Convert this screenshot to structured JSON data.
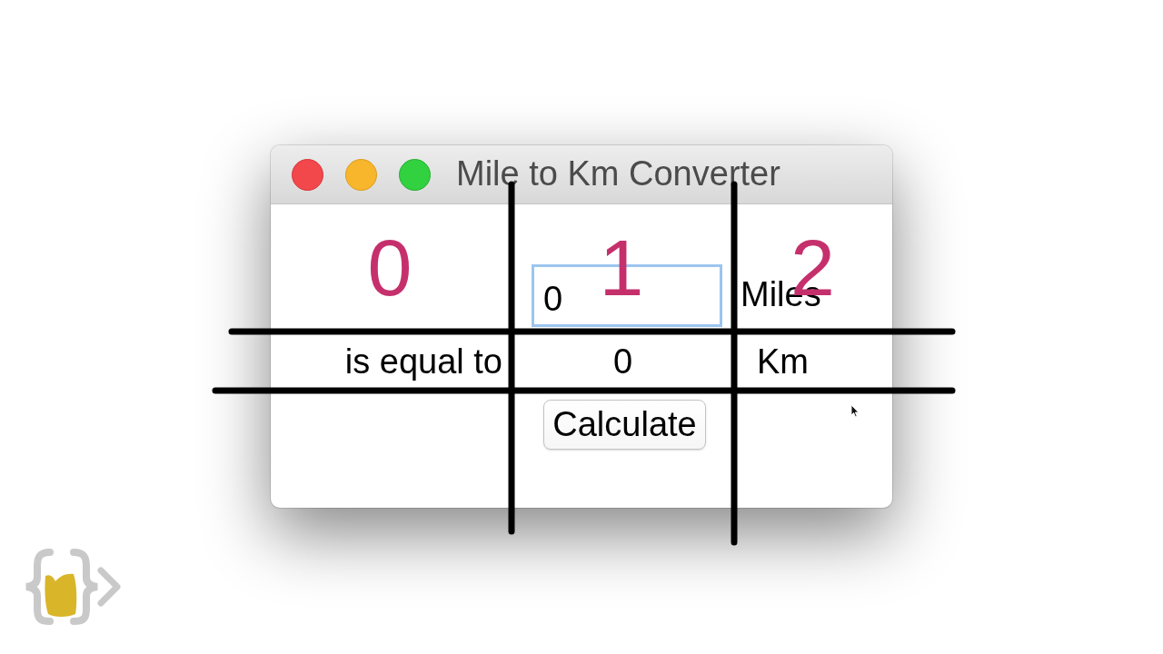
{
  "window": {
    "title": "Mile to Km Converter",
    "buttons": [
      {
        "kind": "close"
      },
      {
        "kind": "minimize"
      },
      {
        "kind": "zoom"
      }
    ]
  },
  "form": {
    "miles_input": {
      "value": "0",
      "focused": true
    },
    "miles_label": "Miles",
    "equal_label": "is equal to",
    "km_result": "0",
    "km_label": "Km",
    "calculate_button": "Calculate"
  },
  "annotation": {
    "column_numbers": [
      "0",
      "1",
      "2"
    ]
  }
}
